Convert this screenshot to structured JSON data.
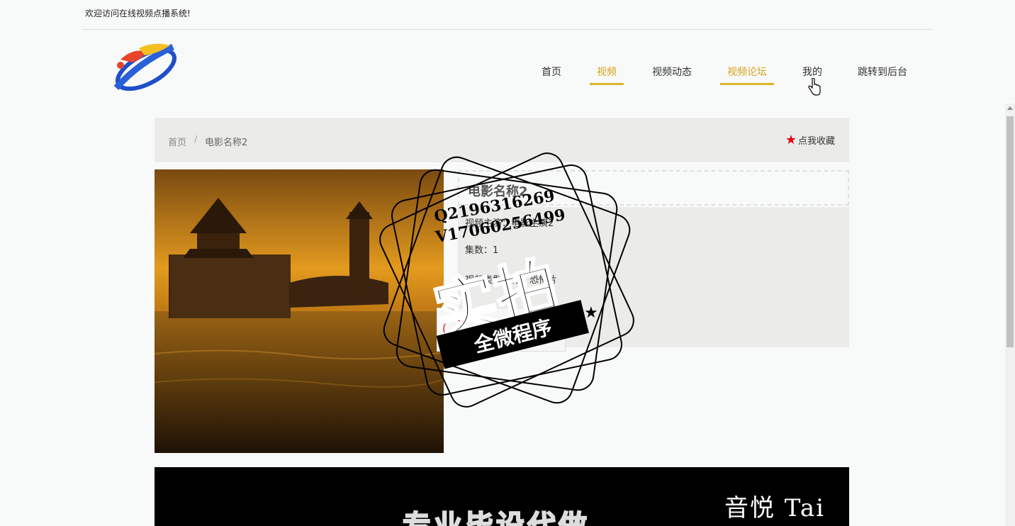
{
  "topbar": {
    "welcome": "欢迎访问在线视频点播系统!"
  },
  "nav": {
    "items": [
      {
        "label": "首页",
        "active": false
      },
      {
        "label": "视频",
        "active": true
      },
      {
        "label": "视频动态",
        "active": false
      },
      {
        "label": "视频论坛",
        "active": true
      },
      {
        "label": "我的",
        "active": false
      },
      {
        "label": "跳转到后台",
        "active": false
      }
    ]
  },
  "breadcrumb": {
    "home": "首页",
    "separator": "/",
    "current": "电影名称2"
  },
  "favorite": {
    "label": "点我收藏",
    "icon": "star-icon",
    "color": "#e60012"
  },
  "video": {
    "title": "电影名称2",
    "actor_line": "视频主演：电影主演2",
    "episodes_line": "集数：1",
    "type_line": "视频类型名称：恐怖片"
  },
  "watermark": {
    "contact1": "Q2196316269",
    "contact2": "V17060256499",
    "big": "实拍",
    "ribbon": "全微程序"
  },
  "banner": {
    "sign": "音悦 Tai",
    "title": "专业毕设代做"
  },
  "colors": {
    "accent": "#e0b42a",
    "favorite_star": "#e60012",
    "panel": "#ebebe9"
  }
}
